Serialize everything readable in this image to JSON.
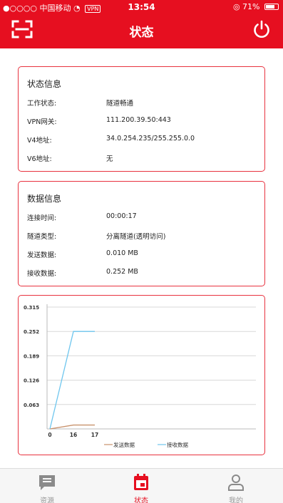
{
  "status_bar": {
    "carrier": "●○○○○ 中国移动",
    "vpn": "VPN",
    "time": "13:54",
    "battery": "71%"
  },
  "header": {
    "title": "状态",
    "scan_icon": "scan-icon",
    "power_icon": "power-icon"
  },
  "status_card": {
    "title": "状态信息",
    "rows": [
      {
        "label": "工作状态:",
        "value": "隧道畅通"
      },
      {
        "label": "VPN网关:",
        "value": "111.200.39.50:443"
      },
      {
        "label": "V4地址:",
        "value": "34.0.254.235/255.255.0.0"
      },
      {
        "label": "V6地址:",
        "value": "无"
      }
    ]
  },
  "data_card": {
    "title": "数据信息",
    "rows": [
      {
        "label": "连接时间:",
        "value": "00:00:17"
      },
      {
        "label": "隧道类型:",
        "value": "分离隧道(透明访问)"
      },
      {
        "label": "发送数据:",
        "value": "0.010 MB"
      },
      {
        "label": "接收数据:",
        "value": "0.252 MB"
      }
    ]
  },
  "chart_data": {
    "type": "line",
    "y_ticks": [
      "0.315",
      "0.252",
      "0.189",
      "0.126",
      "0.063"
    ],
    "x_ticks": [
      "0",
      "16",
      "17"
    ],
    "x": [
      0,
      16,
      17
    ],
    "ylim": [
      0,
      0.315
    ],
    "grid": true,
    "legend_position": "bottom",
    "series": [
      {
        "name": "发送数据",
        "color": "#c8916b",
        "values": [
          0,
          0.01,
          0.01
        ]
      },
      {
        "name": "接收数据",
        "color": "#6ec6ee",
        "values": [
          0,
          0.252,
          0.252
        ]
      }
    ]
  },
  "tabbar": {
    "items": [
      {
        "label": "资源",
        "icon": "message-icon",
        "active": false
      },
      {
        "label": "状态",
        "icon": "calendar-icon",
        "active": true
      },
      {
        "label": "我的",
        "icon": "user-icon",
        "active": false
      }
    ]
  },
  "colors": {
    "accent": "#e60f20",
    "card_border": "#e8323f"
  }
}
